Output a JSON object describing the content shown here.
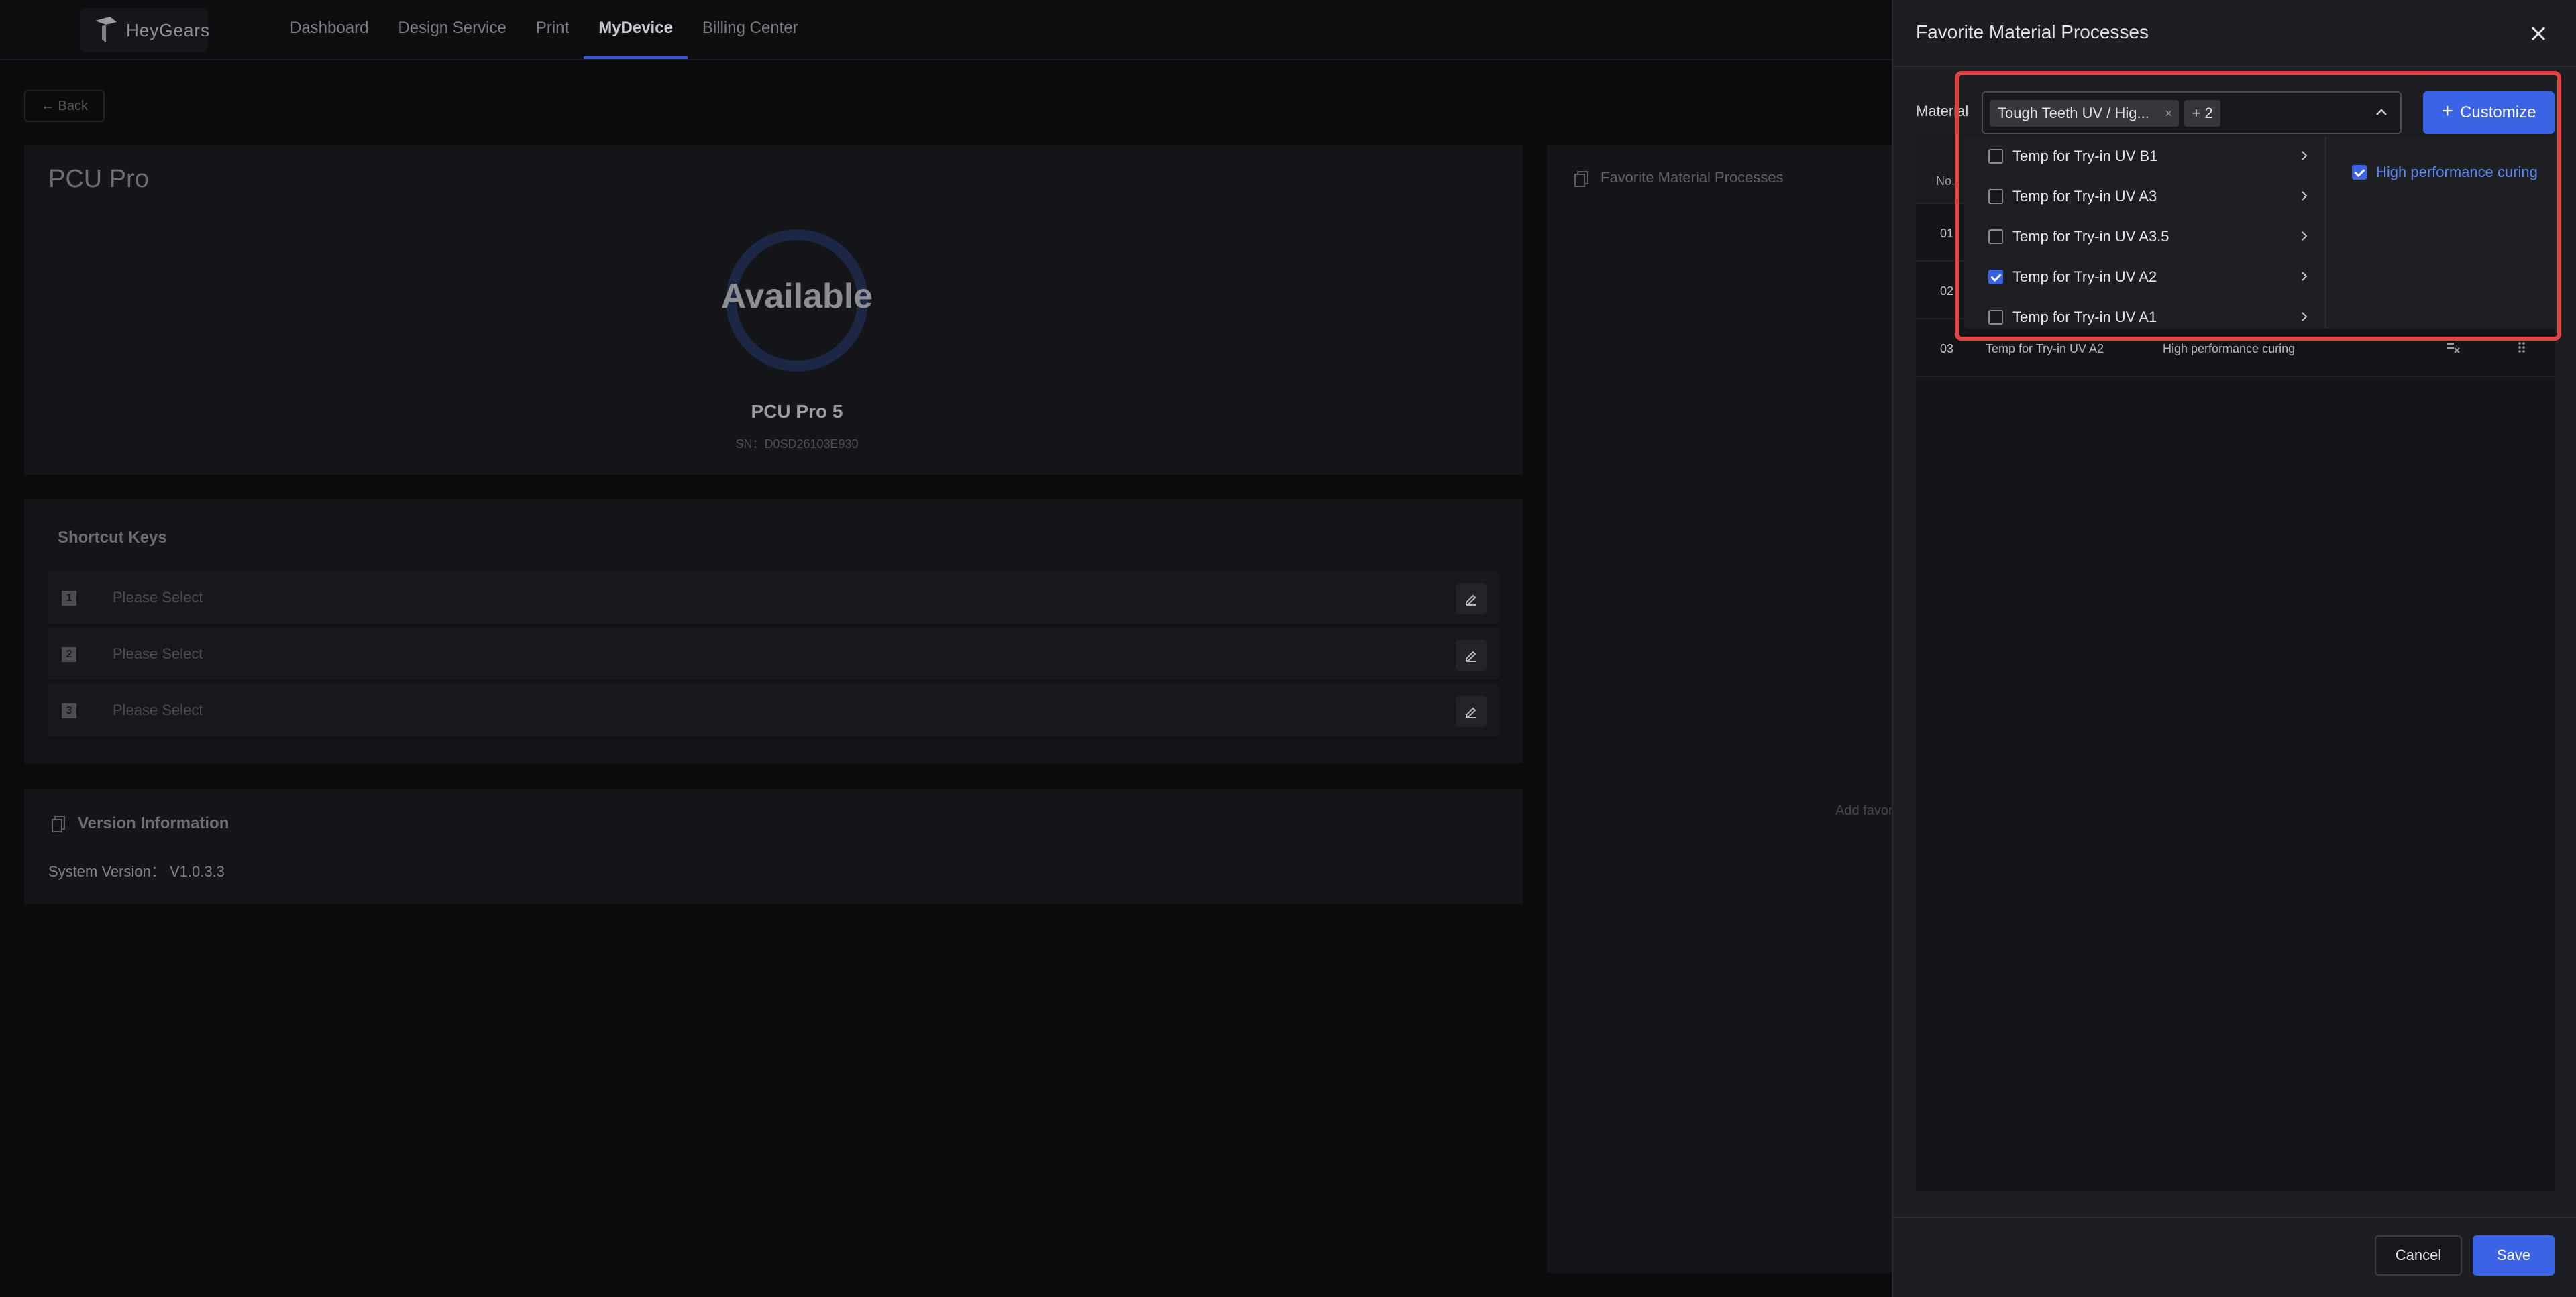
{
  "nav": {
    "logo_text": "HeyGears",
    "items": [
      {
        "label": "Dashboard",
        "active": false
      },
      {
        "label": "Design Service",
        "active": false
      },
      {
        "label": "Print",
        "active": false
      },
      {
        "label": "MyDevice",
        "active": true
      },
      {
        "label": "Billing Center",
        "active": false
      }
    ]
  },
  "back_label": "← Back",
  "device": {
    "title": "PCU Pro",
    "status": "Available",
    "name": "PCU Pro 5",
    "sn": "SN：D0SD26103E930"
  },
  "shortcuts": {
    "title": "Shortcut Keys",
    "items": [
      {
        "num": "1",
        "text": "Please Select"
      },
      {
        "num": "2",
        "text": "Please Select"
      },
      {
        "num": "3",
        "text": "Please Select"
      }
    ]
  },
  "version": {
    "title": "Version Information",
    "line": "System Version：  V1.0.3.3"
  },
  "fav_card": {
    "title": "Favorite Material Processes",
    "add_text": "Add favori"
  },
  "drawer": {
    "title": "Favorite Material Processes",
    "material_label": "Material",
    "tag1": "Tough Teeth UV / Hig...",
    "tag1_close": "×",
    "tag2": "+ 2",
    "customize_label": "Customize",
    "table": {
      "header_no": "No.",
      "rows": [
        {
          "no": "01",
          "material": "",
          "process": ""
        },
        {
          "no": "02",
          "material": "",
          "process": ""
        },
        {
          "no": "03",
          "material": "Temp for Try-in UV A2",
          "process": "High performance curing"
        }
      ]
    },
    "cancel_label": "Cancel",
    "save_label": "Save"
  },
  "dropdown": {
    "options": [
      {
        "label": "Temp for Try-in UV B1",
        "checked": false
      },
      {
        "label": "Temp for Try-in UV A3",
        "checked": false
      },
      {
        "label": "Temp for Try-in UV A3.5",
        "checked": false
      },
      {
        "label": "Temp for Try-in UV A2",
        "checked": true
      },
      {
        "label": "Temp for Try-in UV A1",
        "checked": false
      }
    ],
    "process_option": {
      "label": "High performance curing",
      "checked": true
    }
  },
  "colors": {
    "accent": "#3a63e6",
    "highlight": "#e24242"
  }
}
